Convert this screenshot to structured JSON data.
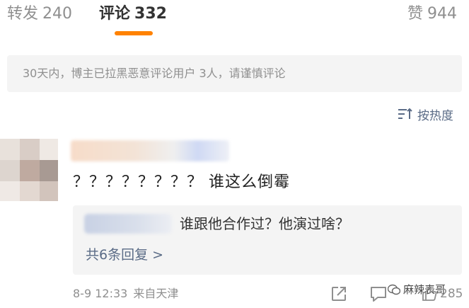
{
  "tabs": {
    "repost": {
      "label": "转发",
      "count": "240"
    },
    "comments": {
      "label": "评论",
      "count": "332"
    },
    "likes": {
      "label": "赞",
      "count": "944"
    }
  },
  "notice": "30天内，博主已拉黑恶意评论用户 3人，请谨慎评论",
  "sort": {
    "label": "按热度",
    "icon": "sort-icon"
  },
  "comment": {
    "text": "？？？？？？？？ 谁这么倒霉",
    "reply": {
      "text": "谁跟他合作过？他演过啥？"
    },
    "more_replies": "共6条回复 >",
    "meta": {
      "time": "8-9 12:33",
      "source": "来自天津"
    },
    "actions": {
      "like_count": "285"
    }
  },
  "watermark": "麻辣表哥",
  "colors": {
    "accent": "#ff8200",
    "link": "#5a6b86",
    "muted": "#8f8f8f"
  }
}
